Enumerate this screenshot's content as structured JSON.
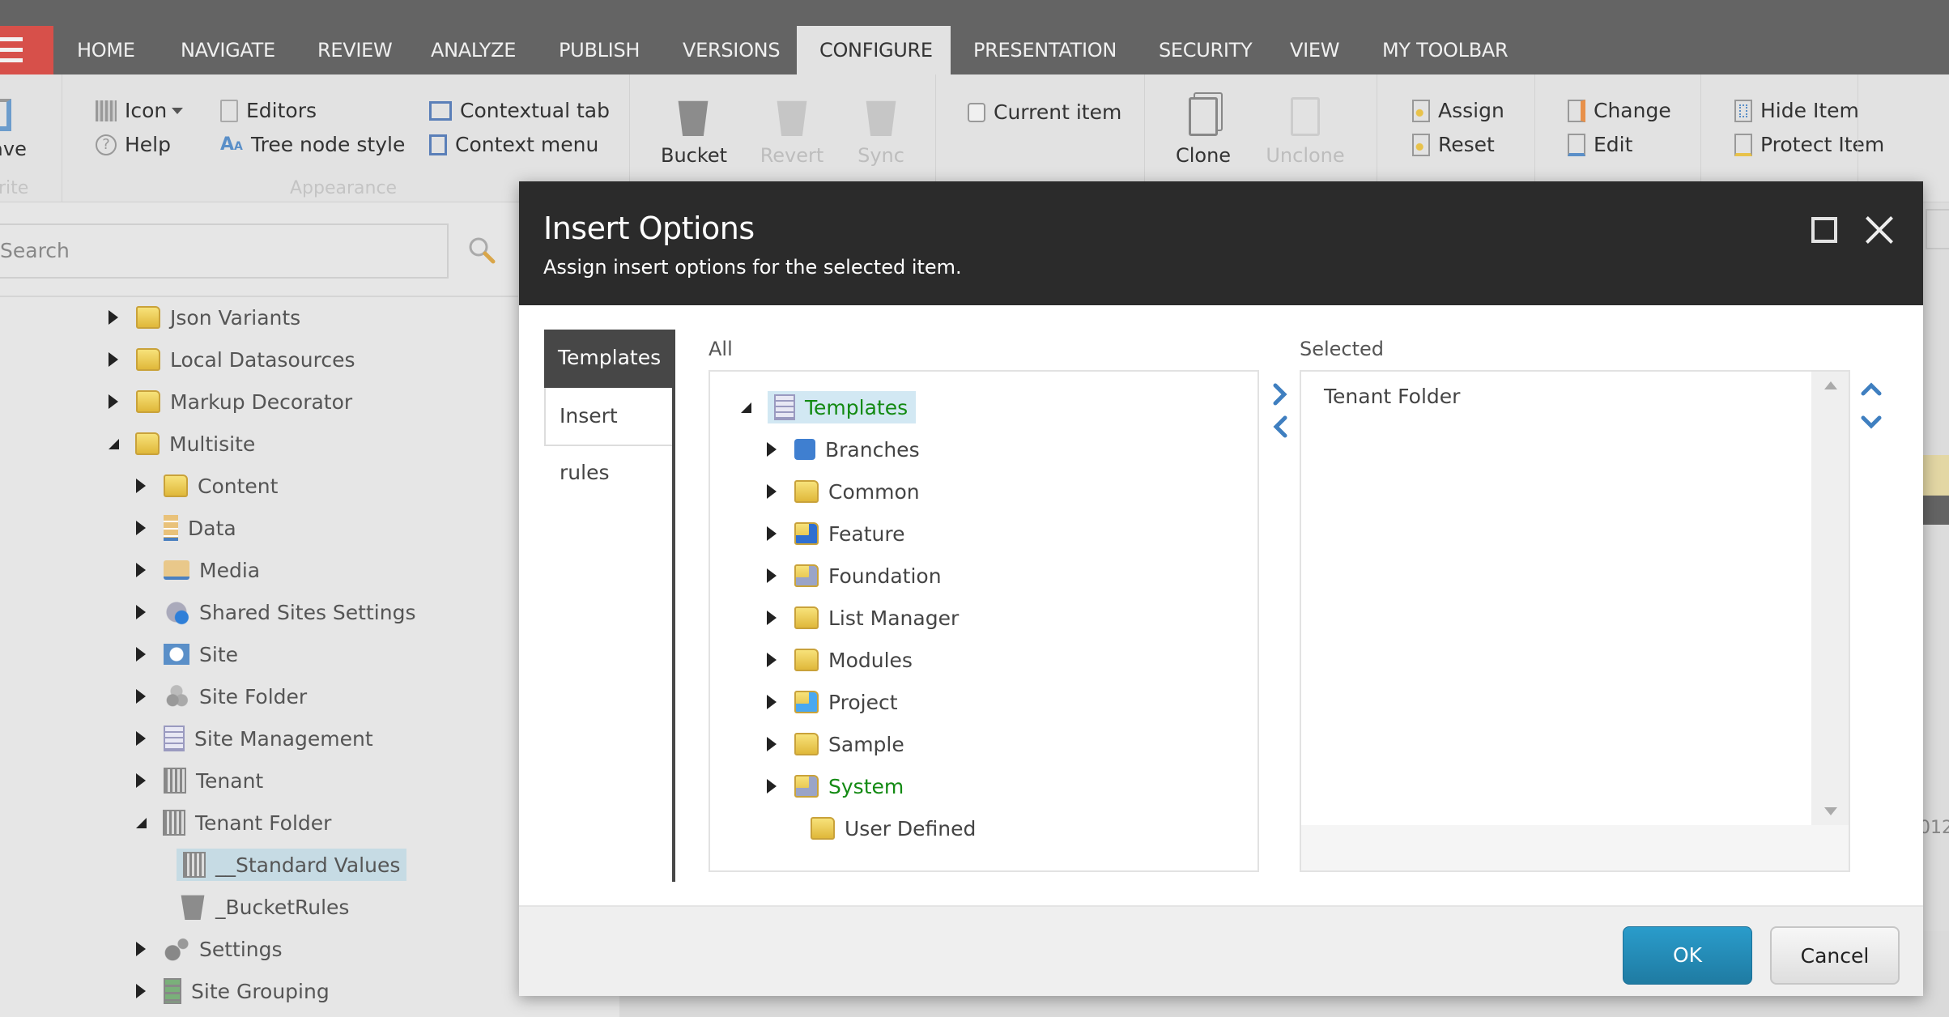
{
  "topnav": {
    "menu_icon": "hamburger-icon",
    "tabs": [
      {
        "label": "HOME"
      },
      {
        "label": "NAVIGATE"
      },
      {
        "label": "REVIEW"
      },
      {
        "label": "ANALYZE"
      },
      {
        "label": "PUBLISH"
      },
      {
        "label": "VERSIONS"
      },
      {
        "label": "CONFIGURE",
        "active": true
      },
      {
        "label": "PRESENTATION"
      },
      {
        "label": "SECURITY"
      },
      {
        "label": "VIEW"
      },
      {
        "label": "MY TOOLBAR"
      }
    ]
  },
  "ribbon": {
    "save": {
      "label": "ave",
      "group": "rite"
    },
    "appearance": {
      "group": "Appearance",
      "icon": "Icon",
      "help": "Help",
      "editors": "Editors",
      "tree_node_style": "Tree node style",
      "contextual_tab": "Contextual tab",
      "context_menu": "Context menu"
    },
    "buckets": {
      "bucket": "Bucket",
      "revert": "Revert",
      "sync": "Sync"
    },
    "current_item": {
      "label": "Current item",
      "checked": false
    },
    "clones": {
      "clone": "Clone",
      "unclone": "Unclone"
    },
    "insert_options": {
      "assign": "Assign",
      "reset": "Reset"
    },
    "template": {
      "change": "Change",
      "edit": "Edit"
    },
    "attributes": {
      "hide_item": "Hide Item",
      "protect_item": "Protect Item"
    }
  },
  "content_tree": {
    "search_placeholder": "Search",
    "items": [
      {
        "label": "Json Variants",
        "level": 0,
        "state": "collapsed",
        "icon": "folder-icon"
      },
      {
        "label": "Local Datasources",
        "level": 0,
        "state": "collapsed",
        "icon": "folder-icon"
      },
      {
        "label": "Markup Decorator",
        "level": 0,
        "state": "collapsed",
        "icon": "folder-icon"
      },
      {
        "label": "Multisite",
        "level": 0,
        "state": "expanded",
        "icon": "folder-icon"
      },
      {
        "label": "Content",
        "level": 1,
        "state": "collapsed",
        "icon": "folder-icon"
      },
      {
        "label": "Data",
        "level": 1,
        "state": "collapsed",
        "icon": "data-server-icon"
      },
      {
        "label": "Media",
        "level": 1,
        "state": "collapsed",
        "icon": "media-folder-icon"
      },
      {
        "label": "Shared Sites Settings",
        "level": 1,
        "state": "collapsed",
        "icon": "settings-info-icon"
      },
      {
        "label": "Site",
        "level": 1,
        "state": "collapsed",
        "icon": "globe-icon"
      },
      {
        "label": "Site Folder",
        "level": 1,
        "state": "collapsed",
        "icon": "cubes-icon"
      },
      {
        "label": "Site Management",
        "level": 1,
        "state": "collapsed",
        "icon": "form-icon"
      },
      {
        "label": "Tenant",
        "level": 1,
        "state": "collapsed",
        "icon": "building-icon"
      },
      {
        "label": "Tenant Folder",
        "level": 1,
        "state": "expanded",
        "icon": "buildings-icon"
      },
      {
        "label": "__Standard Values",
        "level": 2,
        "state": "leaf",
        "icon": "buildings-icon",
        "selected": true
      },
      {
        "label": "_BucketRules",
        "level": 1,
        "state": "leaf",
        "icon": "bucket-rules-icon"
      },
      {
        "label": "Settings",
        "level": 1,
        "state": "collapsed",
        "icon": "gears-icon"
      },
      {
        "label": "Site Grouping",
        "level": 1,
        "state": "collapsed",
        "icon": "server-list-icon"
      }
    ]
  },
  "background": {
    "partial_text": "012"
  },
  "dialog": {
    "title": "Insert Options",
    "subtitle": "Assign insert options for the selected item.",
    "tabs": [
      {
        "label": "Templates",
        "active": true
      },
      {
        "label": "Insert rules",
        "active": false
      }
    ],
    "all_label": "All",
    "selected_label": "Selected",
    "all_tree": [
      {
        "label": "Templates",
        "level": 0,
        "state": "expanded",
        "icon": "template-icon",
        "selected": true,
        "color": "green"
      },
      {
        "label": "Branches",
        "level": 1,
        "state": "collapsed",
        "icon": "puzzle-icon"
      },
      {
        "label": "Common",
        "level": 1,
        "state": "collapsed",
        "icon": "folder-icon"
      },
      {
        "label": "Feature",
        "level": 1,
        "state": "collapsed",
        "icon": "folder-feature-icon"
      },
      {
        "label": "Foundation",
        "level": 1,
        "state": "collapsed",
        "icon": "folder-gear-icon"
      },
      {
        "label": "List Manager",
        "level": 1,
        "state": "collapsed",
        "icon": "folder-icon"
      },
      {
        "label": "Modules",
        "level": 1,
        "state": "collapsed",
        "icon": "folder-icon"
      },
      {
        "label": "Project",
        "level": 1,
        "state": "collapsed",
        "icon": "folder-window-icon"
      },
      {
        "label": "Sample",
        "level": 1,
        "state": "collapsed",
        "icon": "folder-icon"
      },
      {
        "label": "System",
        "level": 1,
        "state": "collapsed",
        "icon": "folder-gear-icon",
        "color": "green"
      },
      {
        "label": "User Defined",
        "level": 1,
        "state": "leaf",
        "icon": "folder-icon"
      }
    ],
    "selected_items": [
      "Tenant Folder"
    ],
    "ok_label": "OK",
    "cancel_label": "Cancel",
    "colors": {
      "header": "#2b2b2b",
      "ok": "#2589b5",
      "green_text": "#138a13",
      "selection": "#d2e8f3",
      "accent_arrow": "#3f7fc0"
    }
  }
}
